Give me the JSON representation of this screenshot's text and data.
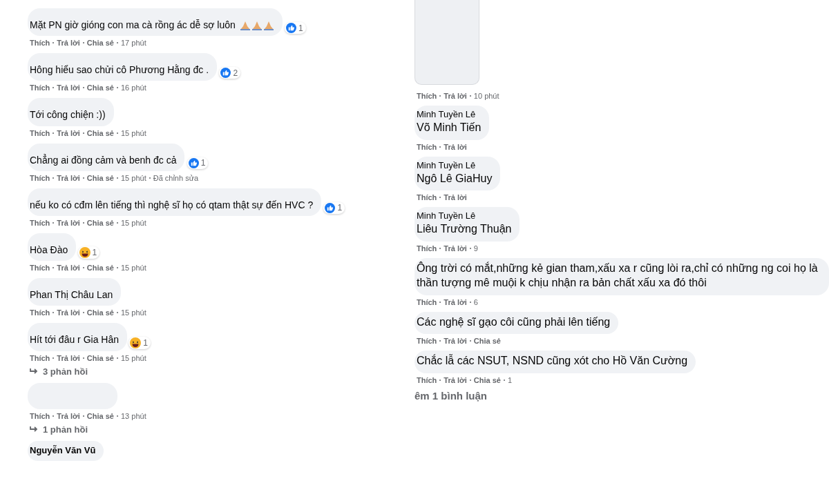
{
  "left_comments": [
    {
      "text": "Mặt PN giờ gióng con ma cà rồng ác dễ sợ luôn",
      "emojis": [
        {
          "kind": "pray"
        },
        {
          "kind": "pray"
        },
        {
          "kind": "pray"
        }
      ],
      "reaction": {
        "kind": "like",
        "count": "1"
      },
      "actions": [
        "Thích",
        "Trả lời",
        "Chia sẻ"
      ],
      "time": "17 phút"
    },
    {
      "text": "Hông hiểu sao chửi cô Phương Hằng đc .",
      "reaction": {
        "kind": "like",
        "count": "2"
      },
      "actions": [
        "Thích",
        "Trả lời",
        "Chia sẻ"
      ],
      "time": "16 phút"
    },
    {
      "text": "Tới công chiện :))",
      "actions": [
        "Thích",
        "Trả lời",
        "Chia sẻ"
      ],
      "time": "15 phút"
    },
    {
      "text": "Chẳng ai đồng cảm và benh đc cả",
      "reaction": {
        "kind": "like",
        "count": "1"
      },
      "actions": [
        "Thích",
        "Trả lời",
        "Chia sẻ"
      ],
      "time": "15 phút",
      "note": "Đã chỉnh sửa"
    },
    {
      "text": "nếu ko có cđm lên tiếng thì nghệ sĩ họ có qtam thật sự đến HVC ?",
      "reaction": {
        "kind": "like",
        "count": "1"
      },
      "actions": [
        "Thích",
        "Trả lời",
        "Chia sẻ"
      ],
      "time": "15 phút"
    },
    {
      "text": "Hòa Đào",
      "reaction": {
        "kind": "haha",
        "count": "1"
      },
      "actions": [
        "Thích",
        "Trả lời",
        "Chia sẻ"
      ],
      "time": "15 phút"
    },
    {
      "text": "Phan Thị Châu Lan",
      "actions": [
        "Thích",
        "Trả lời",
        "Chia sẻ"
      ],
      "time": "15 phút"
    },
    {
      "text": "Hít tới đâu r Gia Hân",
      "reaction": {
        "kind": "haha",
        "count": "1"
      },
      "actions": [
        "Thích",
        "Trả lời",
        "Chia sẻ"
      ],
      "time": "15 phút",
      "replies": "3 phản hồi"
    },
    {
      "actions": [
        "Thích",
        "Trả lời",
        "Chia sẻ"
      ],
      "time": "13 phút",
      "replies": "1 phản hồi"
    },
    {
      "author": "Nguyễn Văn Vũ"
    }
  ],
  "right_top": {
    "actions": [
      "Thích",
      "Trả lời"
    ],
    "time": "10 phút"
  },
  "right_comments": [
    {
      "author": "Minh Tuyền Lê",
      "text": "Võ Minh Tiến",
      "actions": [
        "Thích",
        "Trả lời"
      ]
    },
    {
      "author": "Minh Tuyền Lê",
      "text": "Ngô Lê GiaHuy",
      "actions": [
        "Thích",
        "Trả lời"
      ]
    },
    {
      "author": "Minh Tuyền Lê",
      "text": "Liêu Trường Thuận",
      "actions": [
        "Thích",
        "Trả lời"
      ],
      "time": "9"
    },
    {
      "text": "Ông trời có mắt,những kẻ gian tham,xấu xa r cũng lòi ra,chỉ có những ng coi họ là thần tượng mê muội k chịu nhận ra bản chất xấu xa đó thôi",
      "actions": [
        "Thích",
        "Trả lời"
      ],
      "time": "6"
    },
    {
      "text": "Các nghệ sĩ gạo côi cũng phải lên tiếng",
      "actions": [
        "Thích",
        "Trả lời",
        "Chia sẻ"
      ]
    },
    {
      "text": "Chắc lẫ các NSUT, NSND cũng xót cho Hồ Văn Cường",
      "actions": [
        "Thích",
        "Trả lời",
        "Chia sẻ"
      ],
      "time": "1"
    }
  ],
  "more_comments": "êm 1 bình luận"
}
